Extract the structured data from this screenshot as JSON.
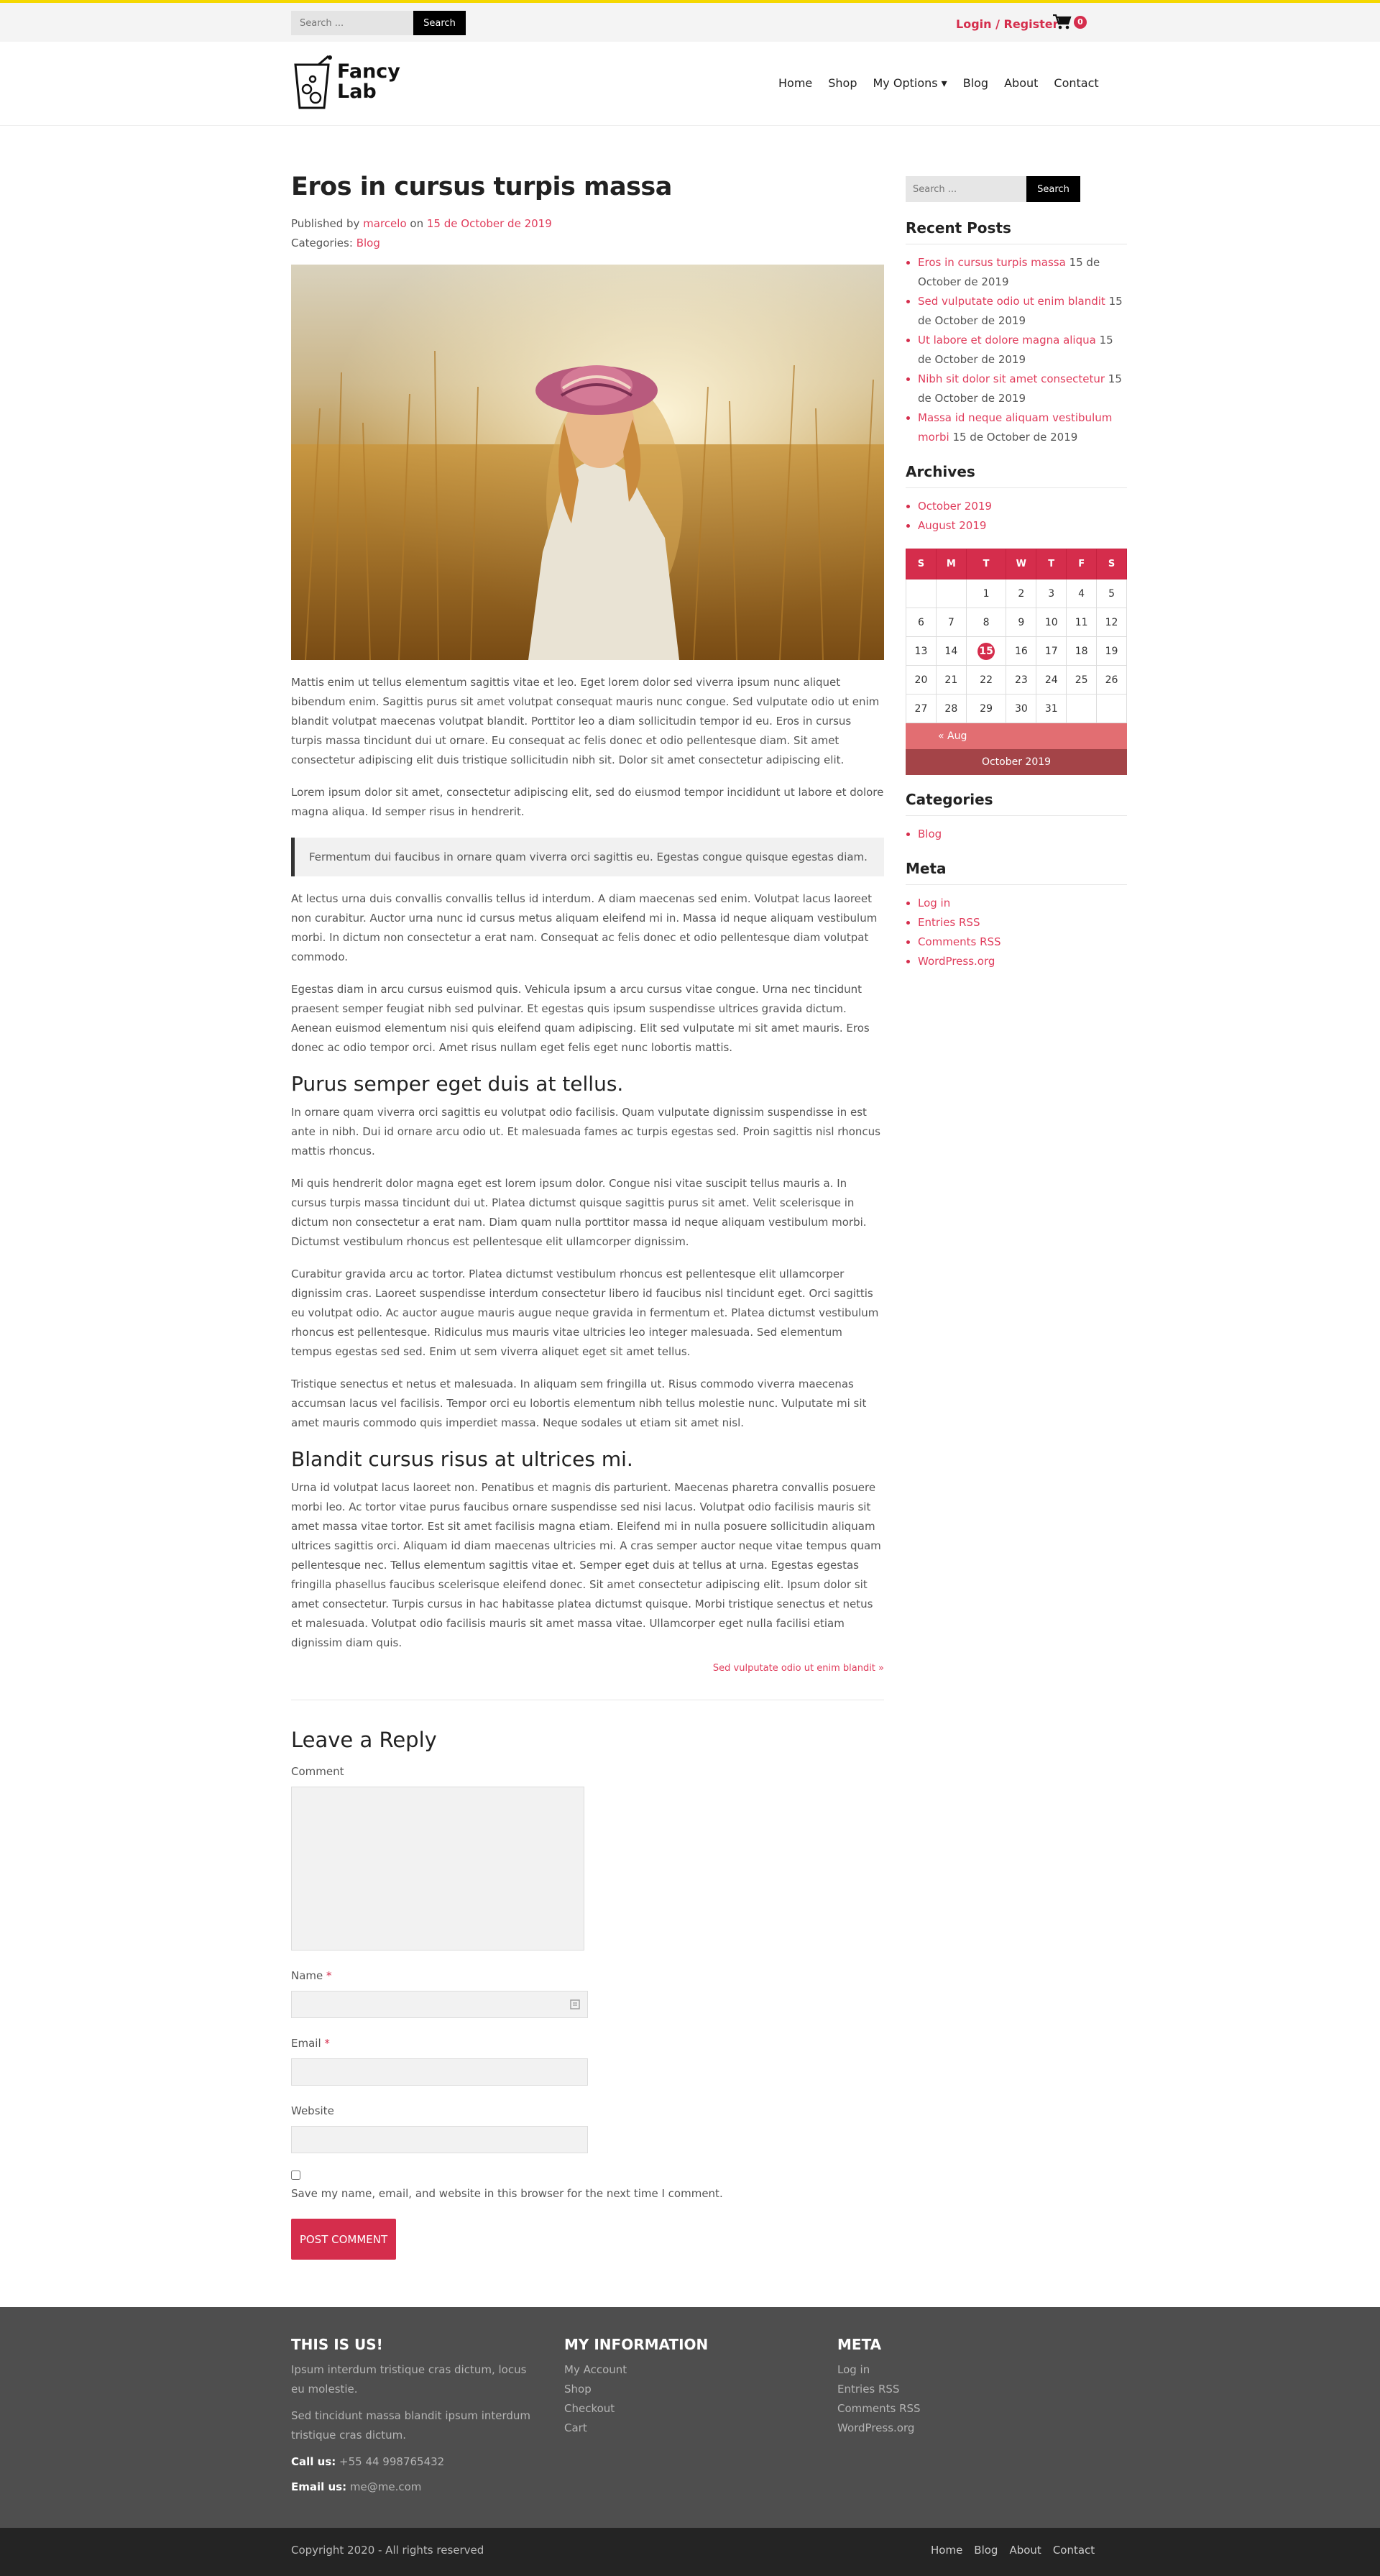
{
  "colors": {
    "accent": "#d52d4c",
    "top_accent": "#f5d800",
    "footer_bg": "#4e4e4e",
    "bottom_bg": "#242424"
  },
  "topbar": {
    "search_placeholder": "Search ...",
    "search_button": "Search",
    "login": "Login / Register",
    "cart_count": "0",
    "cart_icon": "shopping-cart-icon"
  },
  "logo": {
    "text_line1": "Fancy",
    "text_line2": "Lab"
  },
  "nav": {
    "home": "Home",
    "shop": "Shop",
    "options": "My Options ▾",
    "blog": "Blog",
    "about": "About",
    "contact": "Contact"
  },
  "post": {
    "title": "Eros in cursus turpis massa",
    "published_prefix": "Published by",
    "author": "marcelo",
    "on": "on",
    "date": "15 de October de 2019",
    "categories_prefix": "Categories:",
    "category": "Blog",
    "p1": "Mattis enim ut tellus elementum sagittis vitae et leo. Eget lorem dolor sed viverra ipsum nunc aliquet bibendum enim. Sagittis purus sit amet volutpat consequat mauris nunc congue. Sed vulputate odio ut enim blandit volutpat maecenas volutpat blandit. Porttitor leo a diam sollicitudin tempor id eu. Eros in cursus turpis massa tincidunt dui ut ornare. Eu consequat ac felis donec et odio pellentesque diam. Sit amet consectetur adipiscing elit duis tristique sollicitudin nibh sit. Dolor sit amet consectetur adipiscing elit.",
    "p2": "Lorem ipsum dolor sit amet, consectetur adipiscing elit, sed do eiusmod tempor incididunt ut labore et dolore magna aliqua. Id semper risus in hendrerit.",
    "quote": "Fermentum dui faucibus in ornare quam viverra orci sagittis eu. Egestas congue quisque egestas diam.",
    "p3": "At lectus urna duis convallis convallis tellus id interdum. A diam maecenas sed enim. Volutpat lacus laoreet non curabitur. Auctor urna nunc id cursus metus aliquam eleifend mi in. Massa id neque aliquam vestibulum morbi. In dictum non consectetur a erat nam. Consequat ac felis donec et odio pellentesque diam volutpat commodo.",
    "p4": "Egestas diam in arcu cursus euismod quis. Vehicula ipsum a arcu cursus vitae congue. Urna nec tincidunt praesent semper feugiat nibh sed pulvinar. Et egestas quis ipsum suspendisse ultrices gravida dictum. Aenean euismod elementum nisi quis eleifend quam adipiscing. Elit sed vulputate mi sit amet mauris. Eros donec ac odio tempor orci. Amet risus nullam eget felis eget nunc lobortis mattis.",
    "h2a": "Purus semper eget duis at tellus.",
    "p5": "In ornare quam viverra orci sagittis eu volutpat odio facilisis. Quam vulputate dignissim suspendisse in est ante in nibh. Dui id ornare arcu odio ut. Et malesuada fames ac turpis egestas sed. Proin sagittis nisl rhoncus mattis rhoncus.",
    "p6": "Mi quis hendrerit dolor magna eget est lorem ipsum dolor. Congue nisi vitae suscipit tellus mauris a. In cursus turpis massa tincidunt dui ut. Platea dictumst quisque sagittis purus sit amet. Velit scelerisque in dictum non consectetur a erat nam. Diam quam nulla porttitor massa id neque aliquam vestibulum morbi. Dictumst vestibulum rhoncus est pellentesque elit ullamcorper dignissim.",
    "p7": "Curabitur gravida arcu ac tortor. Platea dictumst vestibulum rhoncus est pellentesque elit ullamcorper dignissim cras. Laoreet suspendisse interdum consectetur libero id faucibus nisl tincidunt eget. Orci sagittis eu volutpat odio. Ac auctor augue mauris augue neque gravida in fermentum et. Platea dictumst vestibulum rhoncus est pellentesque. Ridiculus mus mauris vitae ultricies leo integer malesuada. Sed elementum tempus egestas sed sed. Enim ut sem viverra aliquet eget sit amet tellus.",
    "p8": "Tristique senectus et netus et malesuada. In aliquam sem fringilla ut. Risus commodo viverra maecenas accumsan lacus vel facilisis. Tempor orci eu lobortis elementum nibh tellus molestie nunc. Vulputate mi sit amet mauris commodo quis imperdiet massa. Neque sodales ut etiam sit amet nisl.",
    "h2b": "Blandit cursus risus at ultrices mi.",
    "p9": "Urna id volutpat lacus laoreet non. Penatibus et magnis dis parturient. Maecenas pharetra convallis posuere morbi leo. Ac tortor vitae purus faucibus ornare suspendisse sed nisi lacus. Volutpat odio facilisis mauris sit amet massa vitae tortor. Est sit amet facilisis magna etiam. Eleifend mi in nulla posuere sollicitudin aliquam ultrices sagittis orci. Aliquam id diam maecenas ultricies mi. A cras semper auctor neque vitae tempus quam pellentesque nec. Tellus elementum sagittis vitae et. Semper eget duis at tellus at urna. Egestas egestas fringilla phasellus faucibus scelerisque eleifend donec. Sit amet consectetur adipiscing elit. Ipsum dolor sit amet consectetur. Turpis cursus in hac habitasse platea dictumst quisque. Morbi tristique senectus et netus et malesuada. Volutpat odio facilisis mauris sit amet massa vitae. Ullamcorper eget nulla facilisi etiam dignissim diam quis.",
    "next_link": "Sed vulputate odio ut enim blandit »"
  },
  "reply": {
    "title": "Leave a Reply",
    "comment_label": "Comment",
    "name_label": "Name",
    "email_label": "Email",
    "website_label": "Website",
    "required_mark": "*",
    "cookie_text": "Save my name, email, and website in this browser for the next time I comment.",
    "submit": "POST COMMENT"
  },
  "sidebar": {
    "search_placeholder": "Search ...",
    "search_button": "Search",
    "recent_title": "Recent Posts",
    "recent": [
      {
        "title": "Eros in cursus turpis massa",
        "date": "15 de October de 2019"
      },
      {
        "title": "Sed vulputate odio ut enim blandit",
        "date": "15 de October de 2019"
      },
      {
        "title": "Ut labore et dolore magna aliqua",
        "date": "15 de October de 2019"
      },
      {
        "title": "Nibh sit dolor sit amet consectetur",
        "date": "15 de October de 2019"
      },
      {
        "title": "Massa id neque aliquam vestibulum morbi",
        "date": "15 de October de 2019"
      }
    ],
    "archives_title": "Archives",
    "archives": [
      "October 2019",
      "August 2019"
    ],
    "calendar": {
      "days": [
        "S",
        "M",
        "T",
        "W",
        "T",
        "F",
        "S"
      ],
      "weeks": [
        [
          "",
          "",
          "1",
          "2",
          "3",
          "4",
          "5"
        ],
        [
          "6",
          "7",
          "8",
          "9",
          "10",
          "11",
          "12"
        ],
        [
          "13",
          "14",
          "15",
          "16",
          "17",
          "18",
          "19"
        ],
        [
          "20",
          "21",
          "22",
          "23",
          "24",
          "25",
          "26"
        ],
        [
          "27",
          "28",
          "29",
          "30",
          "31",
          "",
          ""
        ]
      ],
      "today": "15",
      "prev": "« Aug",
      "caption": "October 2019"
    },
    "categories_title": "Categories",
    "categories": [
      "Blog"
    ],
    "meta_title": "Meta",
    "meta": [
      "Log in",
      "Entries RSS",
      "Comments RSS",
      "WordPress.org"
    ]
  },
  "footer": {
    "col1_title": "THIS IS US!",
    "col1_p1": "Ipsum interdum tristique cras dictum, locus eu molestie.",
    "col1_p2": "Sed tincidunt massa blandit ipsum interdum tristique cras dictum.",
    "call_label": "Call us:",
    "call_value": "+55 44 998765432",
    "email_label": "Email us:",
    "email_value": "me@me.com",
    "col2_title": "MY INFORMATION",
    "col2": [
      "My Account",
      "Shop",
      "Checkout",
      "Cart"
    ],
    "col3_title": "META",
    "col3": [
      "Log in",
      "Entries RSS",
      "Comments RSS",
      "WordPress.org"
    ],
    "copyright": "Copyright 2020 - All rights reserved",
    "bottom_nav": [
      "Home",
      "Blog",
      "About",
      "Contact"
    ]
  }
}
